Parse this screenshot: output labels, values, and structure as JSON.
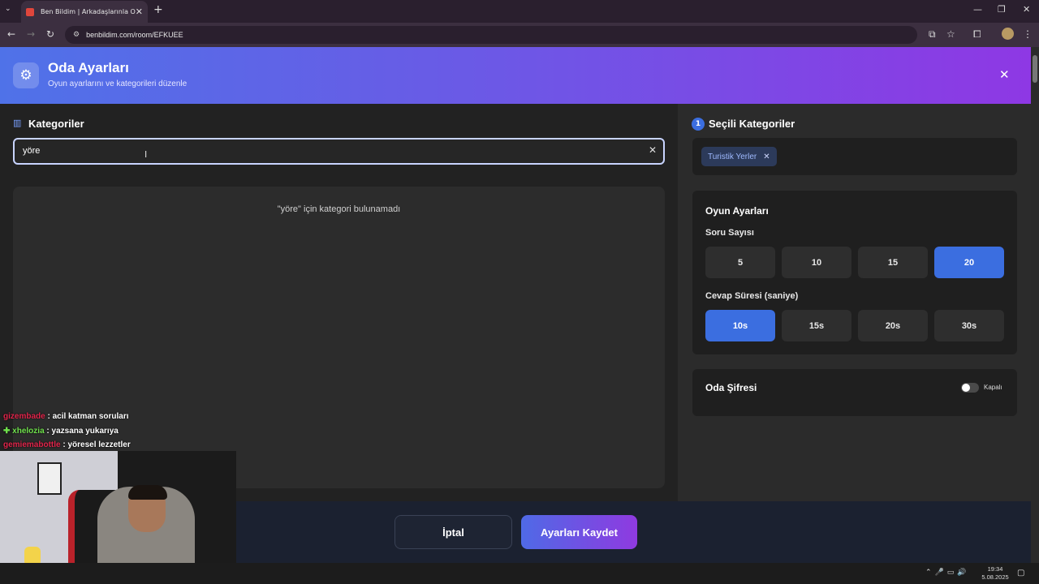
{
  "browser": {
    "tab_title": "Ben Bildim | Arkadaşlarınla Onli",
    "url": "benbildim.com/room/EFKUEE"
  },
  "header": {
    "title": "Oda Ayarları",
    "subtitle": "Oyun ayarlarını ve kategorileri düzenle"
  },
  "categories": {
    "title": "Kategoriler",
    "search_value": "yöre",
    "empty_message": "\"yöre\" için kategori bulunamadı"
  },
  "selected": {
    "count": "1",
    "title": "Seçili Kategoriler",
    "chips": [
      "Turistik Yerler"
    ]
  },
  "game_settings": {
    "title": "Oyun Ayarları",
    "question_count_label": "Soru Sayısı",
    "question_options": [
      "5",
      "10",
      "15",
      "20"
    ],
    "question_selected": "20",
    "answer_time_label": "Cevap Süresi (saniye)",
    "time_options": [
      "10s",
      "15s",
      "20s",
      "30s"
    ],
    "time_selected": "10s"
  },
  "password": {
    "label": "Oda Şifresi",
    "state": "Kapalı",
    "enabled": false
  },
  "footer": {
    "cancel_label": "İptal",
    "save_label": "Ayarları Kaydet"
  },
  "chat": [
    {
      "user": "gizembade",
      "message": ": acil katman soruları"
    },
    {
      "user": "xhelozia",
      "message": ": yazsana yukarıya"
    },
    {
      "user": "gemiemabottle",
      "message": ": yöresel lezzetler"
    }
  ],
  "taskbar": {
    "time": "19:34",
    "date": "5.08.2025"
  },
  "colors": {
    "accent": "#3b6ee0",
    "header_gradient_start": "#4f72e8",
    "header_gradient_end": "#8e38e4"
  }
}
